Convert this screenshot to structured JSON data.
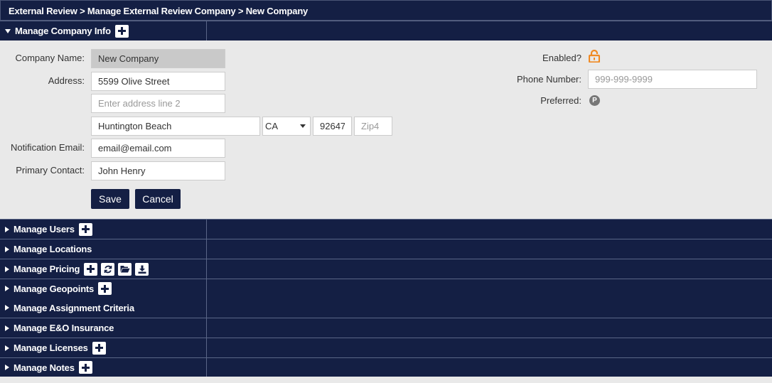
{
  "breadcrumb": "External Review > Manage External Review Company > New Company",
  "company_info": {
    "title": "Manage Company Info",
    "labels": {
      "company_name": "Company Name:",
      "address": "Address:",
      "notification_email": "Notification Email:",
      "primary_contact": "Primary Contact:",
      "enabled": "Enabled?",
      "phone_number": "Phone Number:",
      "preferred": "Preferred:"
    },
    "values": {
      "company_name": "New Company",
      "address_line1": "5599 Olive Street",
      "address_line2": "",
      "city": "Huntington Beach",
      "state": "CA",
      "zip": "92647",
      "zip4": "",
      "notification_email": "email@email.com",
      "primary_contact": "John Henry",
      "phone_number": "999-999-9999"
    },
    "placeholders": {
      "address_line2": "Enter address line 2",
      "zip4": "Zip4"
    },
    "buttons": {
      "save": "Save",
      "cancel": "Cancel"
    },
    "preferred_icon_letter": "P",
    "enabled_icon": "unlock-icon"
  },
  "sections": [
    {
      "title": "Manage Users",
      "icons": [
        "plus-icon"
      ]
    },
    {
      "title": "Manage Locations",
      "icons": []
    },
    {
      "title": "Manage Pricing",
      "icons": [
        "plus-icon",
        "refresh-icon",
        "folder-open-icon",
        "download-icon"
      ]
    },
    {
      "title": "Manage Geopoints",
      "icons": [
        "plus-icon"
      ]
    },
    {
      "title": "Manage Assignment Criteria",
      "icons": []
    },
    {
      "title": "Manage E&O Insurance",
      "icons": []
    },
    {
      "title": "Manage Licenses",
      "icons": [
        "plus-icon"
      ]
    },
    {
      "title": "Manage Notes",
      "icons": [
        "plus-icon"
      ]
    }
  ],
  "colors": {
    "navy": "#141f44",
    "panel": "#e9e9e9",
    "accent_orange": "#f08a24"
  }
}
